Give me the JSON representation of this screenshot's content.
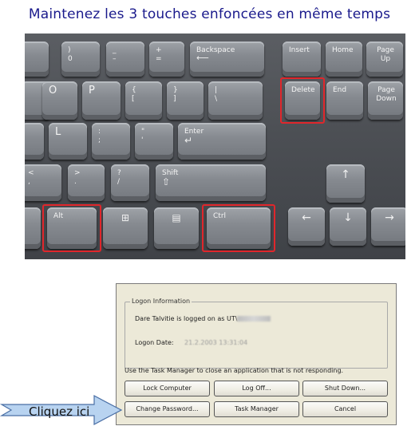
{
  "headline": "Maintenez les 3 touches enfoncées en même temps",
  "keyboard": {
    "keys": {
      "num9": "(\n9",
      "num0": ")\n0",
      "minus": "_\n–",
      "plus": "+\n=",
      "backspace": "Backspace",
      "insert": "Insert",
      "home": "Home",
      "pageup": "Page\nUp",
      "o": "O",
      "p": "P",
      "brace_open": "{\n[",
      "brace_close": "}\n]",
      "pipe": "|\n\\",
      "delete": "Delete",
      "end": "End",
      "pagedown": "Page\nDown",
      "l": "L",
      "colon": ":\n;",
      "quote": "\"\n'",
      "enter": "Enter",
      "comma": "<\n,",
      "period": ">\n.",
      "slash": "?\n/",
      "shift": "Shift",
      "up": "↑",
      "alt": "Alt",
      "ctrl": "Ctrl",
      "left": "←",
      "down": "↓",
      "right": "→"
    },
    "highlight_color": "#e0262b"
  },
  "dialog": {
    "group_title": "Logon Information",
    "logged_on": "Dare Talvitie is logged on as UT\\",
    "logon_date_label": "Logon Date:",
    "logon_date_value": "21.2.2003 13:31:04",
    "message": "Use the Task Manager to close an application that is not responding.",
    "buttons": {
      "lock": "Lock Computer",
      "logoff": "Log Off...",
      "shutdown": "Shut Down...",
      "change_password": "Change Password...",
      "task_manager": "Task Manager",
      "cancel": "Cancel"
    }
  },
  "callout": {
    "label": "Cliquez ici",
    "color": "#b8d3f0"
  }
}
